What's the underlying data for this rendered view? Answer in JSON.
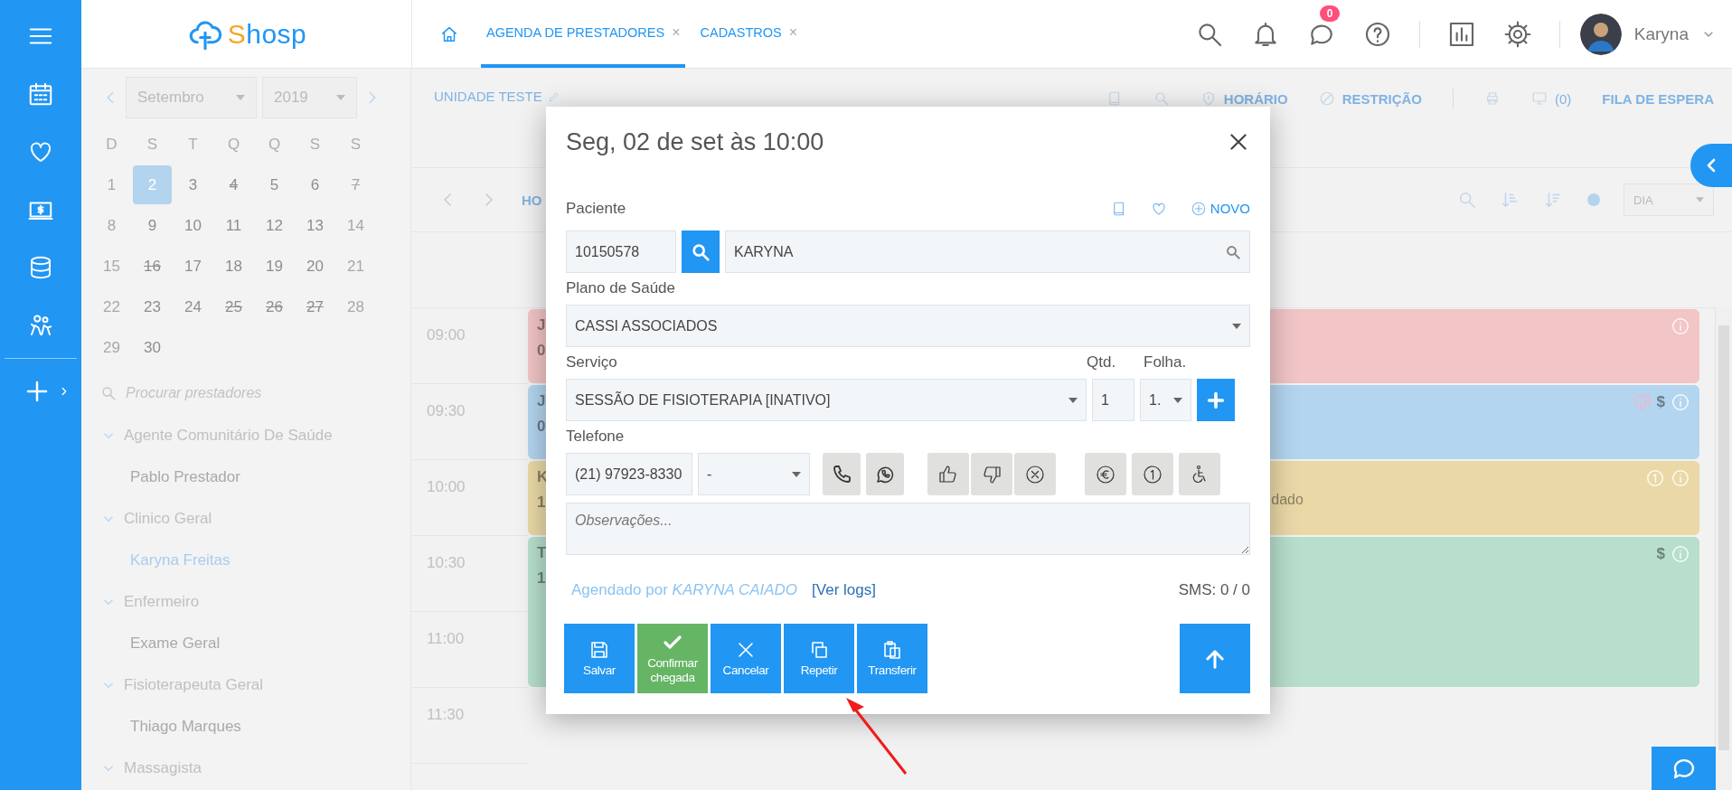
{
  "logo": {
    "text": "Shosp"
  },
  "tabs": [
    {
      "label": "AGENDA DE PRESTADORES",
      "selected": true,
      "close": "×"
    },
    {
      "label": "CADASTROS",
      "selected": false,
      "close": "×"
    }
  ],
  "header": {
    "chat_badge": "0",
    "user": "Karyna"
  },
  "calendar": {
    "month": "Setembro",
    "year": "2019",
    "weekdays": [
      "D",
      "S",
      "T",
      "Q",
      "Q",
      "S",
      "S"
    ],
    "days": [
      {
        "label": "1",
        "selected": false,
        "struck": false,
        "muted": true
      },
      {
        "label": "2",
        "selected": true,
        "struck": false,
        "muted": false
      },
      {
        "label": "3",
        "selected": false,
        "struck": false,
        "muted": false
      },
      {
        "label": "4",
        "selected": false,
        "struck": true,
        "muted": false
      },
      {
        "label": "5",
        "selected": false,
        "struck": false,
        "muted": false
      },
      {
        "label": "6",
        "selected": false,
        "struck": false,
        "muted": false
      },
      {
        "label": "7",
        "selected": false,
        "struck": true,
        "muted": true
      },
      {
        "label": "8",
        "selected": false,
        "struck": false,
        "muted": true
      },
      {
        "label": "9",
        "selected": false,
        "struck": false,
        "muted": false
      },
      {
        "label": "10",
        "selected": false,
        "struck": false,
        "muted": false
      },
      {
        "label": "11",
        "selected": false,
        "struck": false,
        "muted": false
      },
      {
        "label": "12",
        "selected": false,
        "struck": false,
        "muted": false
      },
      {
        "label": "13",
        "selected": false,
        "struck": false,
        "muted": false
      },
      {
        "label": "14",
        "selected": false,
        "struck": false,
        "muted": true
      },
      {
        "label": "15",
        "selected": false,
        "struck": false,
        "muted": true
      },
      {
        "label": "16",
        "selected": false,
        "struck": true,
        "muted": false
      },
      {
        "label": "17",
        "selected": false,
        "struck": false,
        "muted": false
      },
      {
        "label": "18",
        "selected": false,
        "struck": false,
        "muted": false
      },
      {
        "label": "19",
        "selected": false,
        "struck": false,
        "muted": false
      },
      {
        "label": "20",
        "selected": false,
        "struck": false,
        "muted": false
      },
      {
        "label": "21",
        "selected": false,
        "struck": false,
        "muted": true
      },
      {
        "label": "22",
        "selected": false,
        "struck": false,
        "muted": true
      },
      {
        "label": "23",
        "selected": false,
        "struck": false,
        "muted": false
      },
      {
        "label": "24",
        "selected": false,
        "struck": false,
        "muted": false
      },
      {
        "label": "25",
        "selected": false,
        "struck": true,
        "muted": false
      },
      {
        "label": "26",
        "selected": false,
        "struck": true,
        "muted": false
      },
      {
        "label": "27",
        "selected": false,
        "struck": true,
        "muted": false
      },
      {
        "label": "28",
        "selected": false,
        "struck": false,
        "muted": true
      },
      {
        "label": "29",
        "selected": false,
        "struck": false,
        "muted": true
      },
      {
        "label": "30",
        "selected": false,
        "struck": false,
        "muted": false
      }
    ]
  },
  "provider_search": {
    "placeholder": "Procurar prestadores"
  },
  "providers": [
    {
      "label": "Agente Comunitário De Saúde",
      "expanded": true,
      "children": [
        {
          "label": "Pablo Prestador",
          "selected": false
        }
      ]
    },
    {
      "label": "Clinico Geral",
      "expanded": true,
      "children": [
        {
          "label": "Karyna Freitas",
          "selected": true
        }
      ]
    },
    {
      "label": "Enfermeiro",
      "expanded": true,
      "children": [
        {
          "label": "Exame Geral",
          "selected": false
        }
      ]
    },
    {
      "label": "Fisioterapeuta Geral",
      "expanded": true,
      "children": [
        {
          "label": "Thiago Marques",
          "selected": false
        }
      ]
    },
    {
      "label": "Massagista",
      "expanded": true
    }
  ],
  "toolbar": {
    "unit": "UNIDADE TESTE",
    "schedule": "HORÁRIO",
    "restriction": "RESTRIÇÃO",
    "queue_count": "(0)",
    "queue": "FILA DE ESPERA"
  },
  "agenda": {
    "nav_fragment": "HO",
    "view": "DIA",
    "times": [
      "09:00",
      "09:30",
      "10:00",
      "10:30",
      "11:00",
      "11:30"
    ],
    "events": [
      {
        "color": "#f2c5c7",
        "kind": "single",
        "line_1": "J",
        "line_2": "0",
        "badges": [
          {
            "kind": "info"
          }
        ]
      },
      {
        "color": "#b3d5ef",
        "kind": "single",
        "line_1": "J",
        "line_2": "0",
        "badges": [
          {
            "kind": "dislike"
          },
          {
            "kind": "text",
            "text": "$"
          },
          {
            "kind": "info"
          }
        ]
      },
      {
        "color": "#ead9a7",
        "kind": "single",
        "line_1": "K",
        "line_2": "1",
        "status": "dado",
        "badges": [
          {
            "kind": "one"
          },
          {
            "kind": "info"
          }
        ]
      },
      {
        "color": "#b7dfcc",
        "kind": "double",
        "line_1": "T",
        "line_2": "1",
        "badges": [
          {
            "kind": "text",
            "text": "$"
          },
          {
            "kind": "info"
          }
        ]
      }
    ]
  },
  "dialog": {
    "title": "Seg, 02 de set às 10:00",
    "patient_label": "Paciente",
    "new_link": "NOVO",
    "patient_code": "10150578",
    "patient_name": "KARYNA",
    "plan_label": "Plano de Saúde",
    "plan": "CASSI ASSOCIADOS",
    "service_label": "Serviço",
    "qty_label": "Qtd.",
    "sheet_label": "Folha.",
    "service": "SESSÃO DE FISIOTERAPIA [INATIVO]",
    "qty": "1",
    "sheet": "1.",
    "phone_label": "Telefone",
    "phone": "(21) 97923-8330",
    "phone_type": "-",
    "notes_placeholder": "Observações...",
    "scheduled_by": "Agendado por *KARYNA CAIADO*",
    "logs_link": "[Ver logs]",
    "sms": "SMS: 0 / 0",
    "actions": [
      {
        "label": "Salvar",
        "kind": "save"
      },
      {
        "label": "Confirmar chegada",
        "kind": "confirm"
      },
      {
        "label": "Cancelar",
        "kind": "cancel"
      },
      {
        "label": "Repetir",
        "kind": "repeat"
      },
      {
        "label": "Transferir",
        "kind": "transfer"
      }
    ]
  }
}
